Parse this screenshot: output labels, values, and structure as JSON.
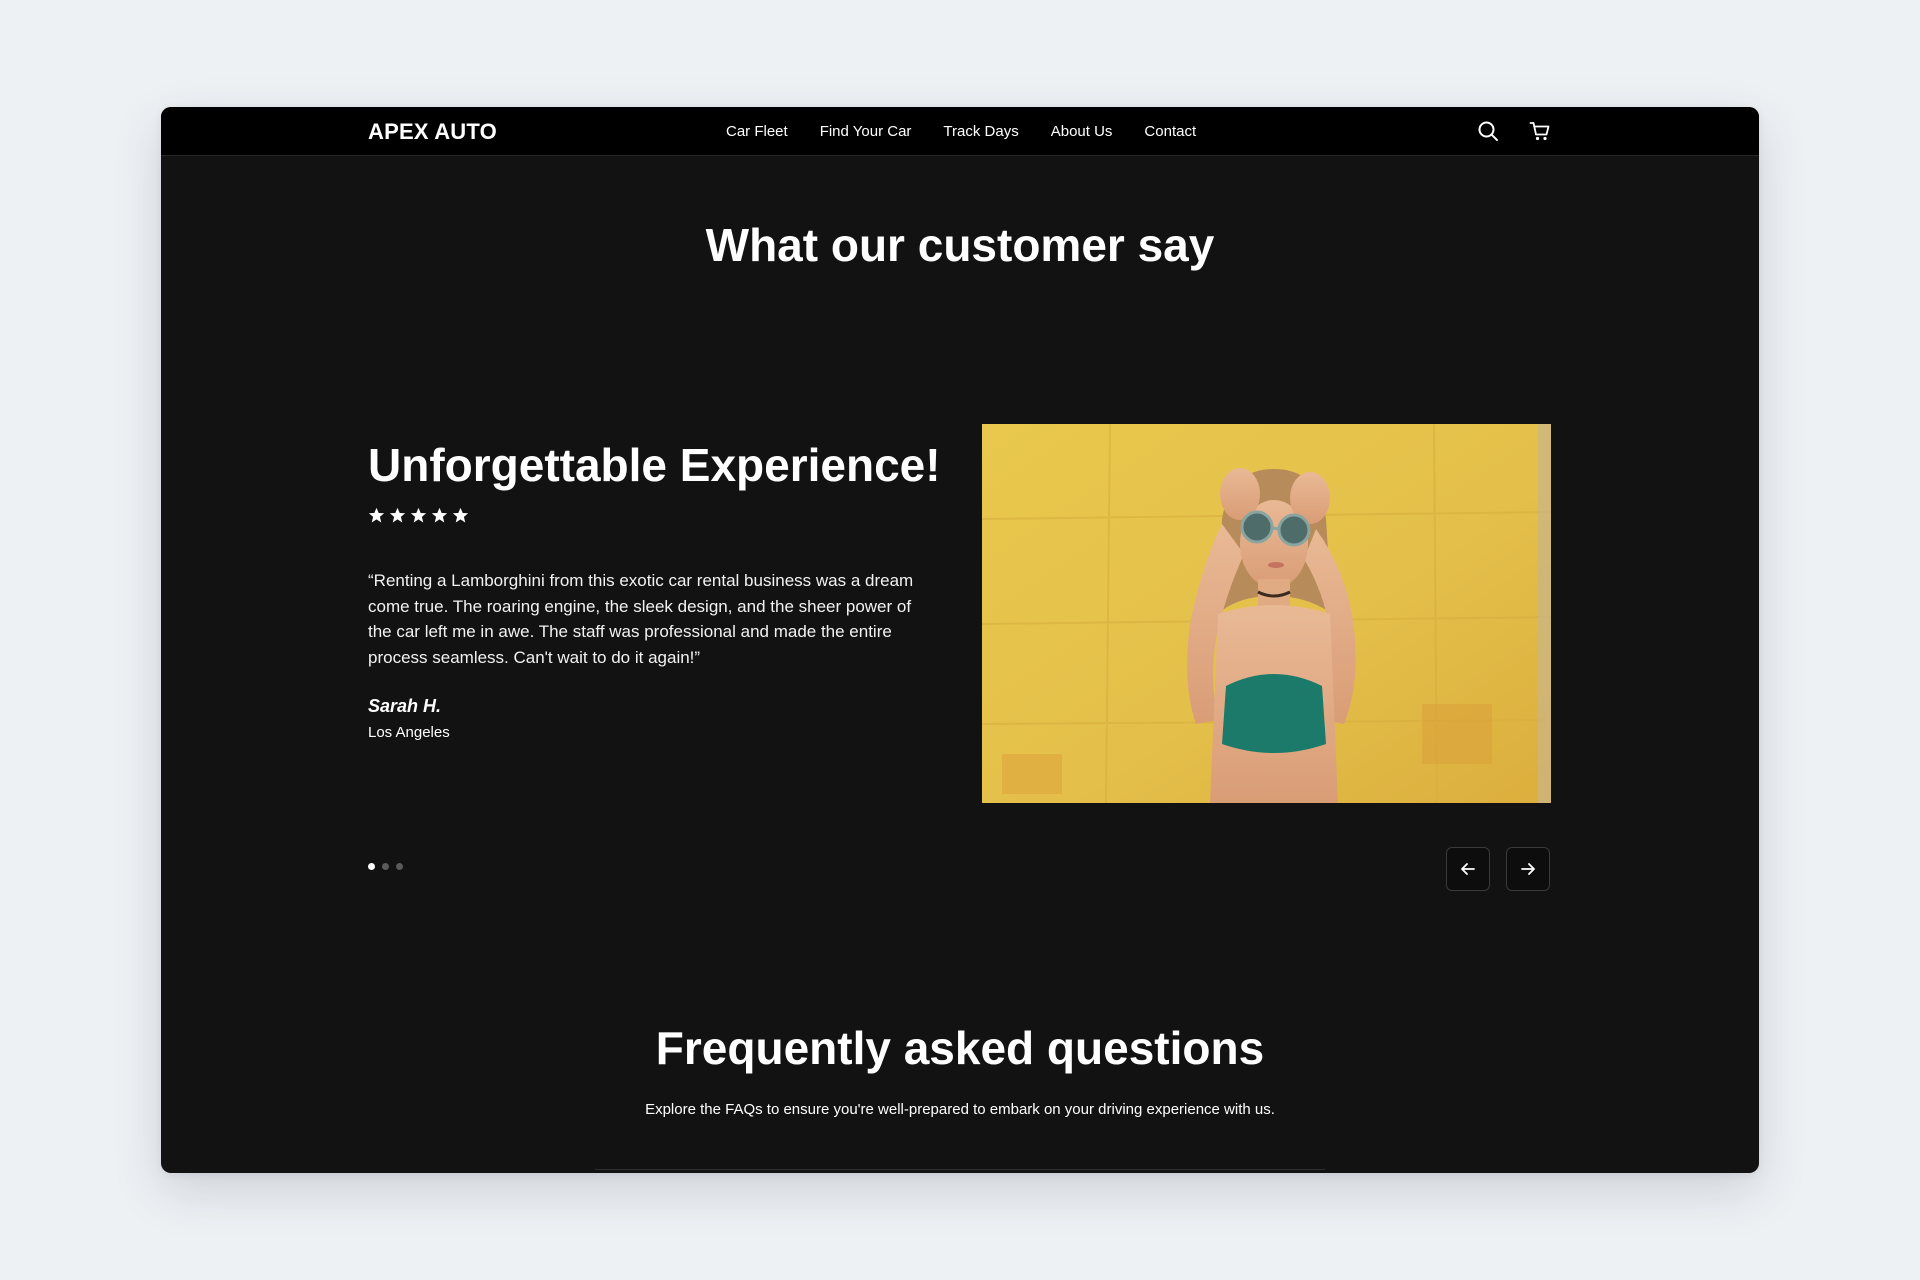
{
  "brand": {
    "logo_text": "APEX AUTO"
  },
  "nav": {
    "links": [
      "Car Fleet",
      "Find Your Car",
      "Track Days",
      "About Us",
      "Contact"
    ],
    "icons": [
      "search-icon",
      "cart-icon"
    ]
  },
  "testimonials": {
    "heading": "What our customer say",
    "current": {
      "title": "Unforgettable Experience!",
      "rating": 5,
      "quote": "“Renting a Lamborghini from this exotic car rental business was a dream come true. The roaring engine, the sleek design, and the sheer power of the car left me in awe. The staff was professional and made the entire process seamless. Can't wait to do it again!”",
      "author": "Sarah H.",
      "location": "Los Angeles"
    },
    "slide_count": 3,
    "active_slide": 1,
    "controls": [
      "arrow-left-icon",
      "arrow-right-icon"
    ]
  },
  "faq": {
    "heading": "Frequently asked questions",
    "subtitle": "Explore the FAQs to ensure you're well-prepared to embark on your driving experience with us."
  },
  "colors": {
    "page_bg": "#eef1f4",
    "window_bg": "#121212",
    "nav_bg": "#000000",
    "text": "#ffffff",
    "photo_wall": "#e3c048",
    "top_teal": "#1b7a6a"
  }
}
